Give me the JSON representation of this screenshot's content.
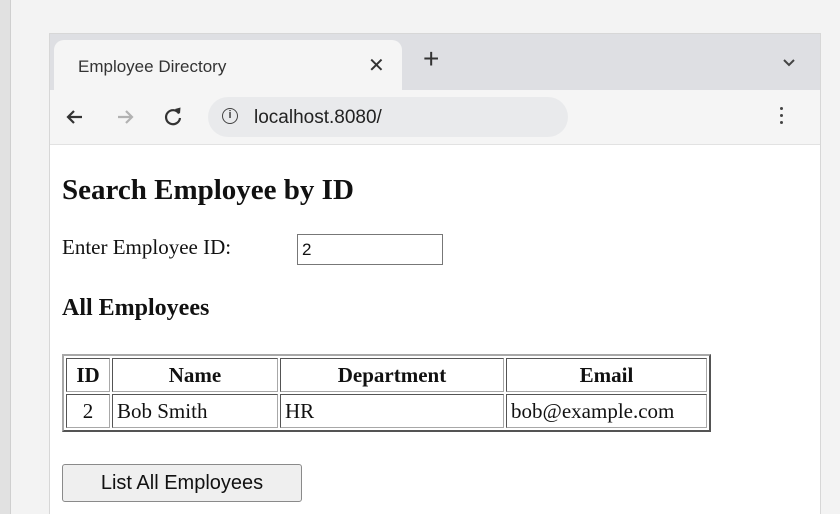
{
  "browser": {
    "tab": {
      "title": "Employee Directory"
    },
    "new_tab_label": "+",
    "address_bar": {
      "url": "localhost.8080/"
    }
  },
  "page": {
    "heading": "Search Employee by ID",
    "search": {
      "label": "Enter Employee ID:",
      "value": "2"
    },
    "table_heading": "All Employees",
    "table": {
      "columns": [
        "ID",
        "Name",
        "Department",
        "Email"
      ],
      "rows": [
        [
          "2",
          "Bob Smith",
          "HR",
          "bob@example.com"
        ]
      ]
    },
    "list_button_label": "List All Employees"
  }
}
